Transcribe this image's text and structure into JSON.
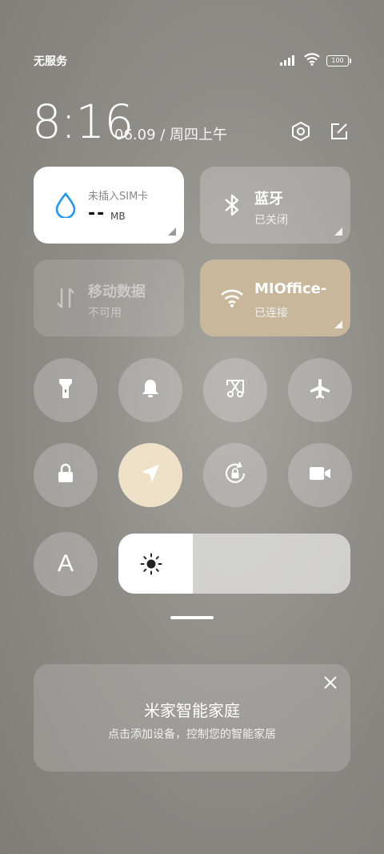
{
  "status": {
    "carrier": "无服务",
    "battery": "100"
  },
  "header": {
    "time": "8:16",
    "date": "06.09 / 周四上午"
  },
  "tiles": {
    "data": {
      "title": "未插入SIM卡",
      "value": "--",
      "unit": "MB"
    },
    "bluetooth": {
      "title": "蓝牙",
      "status": "已关闭"
    },
    "mobile": {
      "title": "移动数据",
      "status": "不可用"
    },
    "wifi": {
      "title": "MIOffice-",
      "status": "已连接"
    }
  },
  "toggles": [
    {
      "name": "flashlight-icon",
      "active": false
    },
    {
      "name": "bell-icon",
      "active": false
    },
    {
      "name": "screenshot-icon",
      "active": false
    },
    {
      "name": "airplane-icon",
      "active": false
    },
    {
      "name": "lock-icon",
      "active": false
    },
    {
      "name": "location-icon",
      "active": true
    },
    {
      "name": "rotation-lock-icon",
      "active": false
    },
    {
      "name": "video-icon",
      "active": false
    }
  ],
  "brightness": {
    "label": "A",
    "level": 0.32
  },
  "smart_home": {
    "title": "米家智能家庭",
    "subtitle": "点击添加设备，控制您的智能家居"
  },
  "colors": {
    "active_toggle": "#efe1c8",
    "wifi_tile": "#c8b79a",
    "tile_white": "#ffffff",
    "data_icon": "#2196f3"
  }
}
